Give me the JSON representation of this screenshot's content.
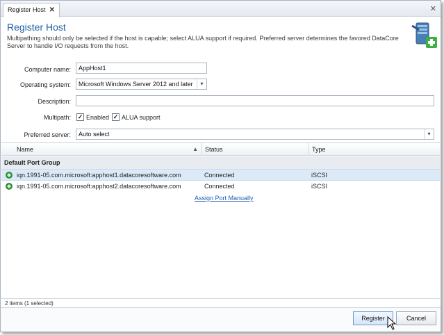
{
  "tab": {
    "label": "Register Host",
    "close": "✕"
  },
  "window": {
    "close": "✕"
  },
  "header": {
    "title": "Register Host",
    "description": "Multipathing should only be selected if the host is capable; select ALUA support if required. Preferred server determines the favored DataCore Server to handle I/O requests from the host."
  },
  "form": {
    "computer_name": {
      "label": "Computer name:",
      "value": "AppHost1"
    },
    "operating_system": {
      "label": "Operating system:",
      "value": "Microsoft Windows Server 2012 and later"
    },
    "description": {
      "label": "Description:",
      "value": ""
    },
    "multipath": {
      "label": "Multipath:",
      "enabled": {
        "label": "Enabled",
        "checked": true,
        "mark": "✓"
      },
      "alua": {
        "label": "ALUA support",
        "checked": true,
        "mark": "✓"
      }
    },
    "preferred_server": {
      "label": "Preferred server:",
      "value": "Auto select"
    }
  },
  "grid": {
    "columns": [
      "Name",
      "Status",
      "Type"
    ],
    "group": "Default Port Group",
    "rows": [
      {
        "name": "iqn.1991-05.com.microsoft:apphost1.datacoresoftware.com",
        "status": "Connected",
        "type": "iSCSI",
        "selected": true
      },
      {
        "name": "iqn.1991-05.com.microsoft:apphost2.datacoresoftware.com",
        "status": "Connected",
        "type": "iSCSI",
        "selected": false
      }
    ],
    "assign_link": "Assign Port Manually"
  },
  "status_bar": "2 items (1 selected)",
  "buttons": {
    "register": "Register",
    "cancel": "Cancel"
  },
  "icons": {
    "logo": "server-add-icon",
    "port": "port-icon",
    "dropdown": "chevron-down-icon",
    "sort": "sort-up-icon"
  },
  "colors": {
    "title": "#1f5fa8",
    "selection": "#dce9f7",
    "link": "#1f5fb3",
    "accent_plus": "#3cb043"
  }
}
